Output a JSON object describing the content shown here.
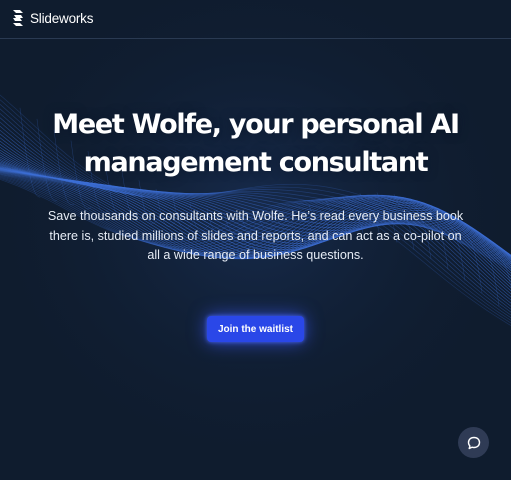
{
  "brand": {
    "name": "Slideworks",
    "logo_icon": "slideworks-logo-icon"
  },
  "hero": {
    "headline_line1": "Meet Wolfe, your personal AI",
    "headline_line2": "management consultant",
    "subtext_line1": "Save thousands on consultants with Wolfe. He’s read every business book",
    "subtext_line2": "there is, studied millions of slides and reports, and can act as a co-pilot on",
    "subtext_line3": "all a wide range of business questions.",
    "cta_label": "Join the waitlist"
  },
  "chat_widget": {
    "icon": "chat-bubble-icon"
  },
  "colors": {
    "background": "#0f1c2e",
    "accent": "#2a47e8",
    "wave": "#3d6fd6"
  }
}
